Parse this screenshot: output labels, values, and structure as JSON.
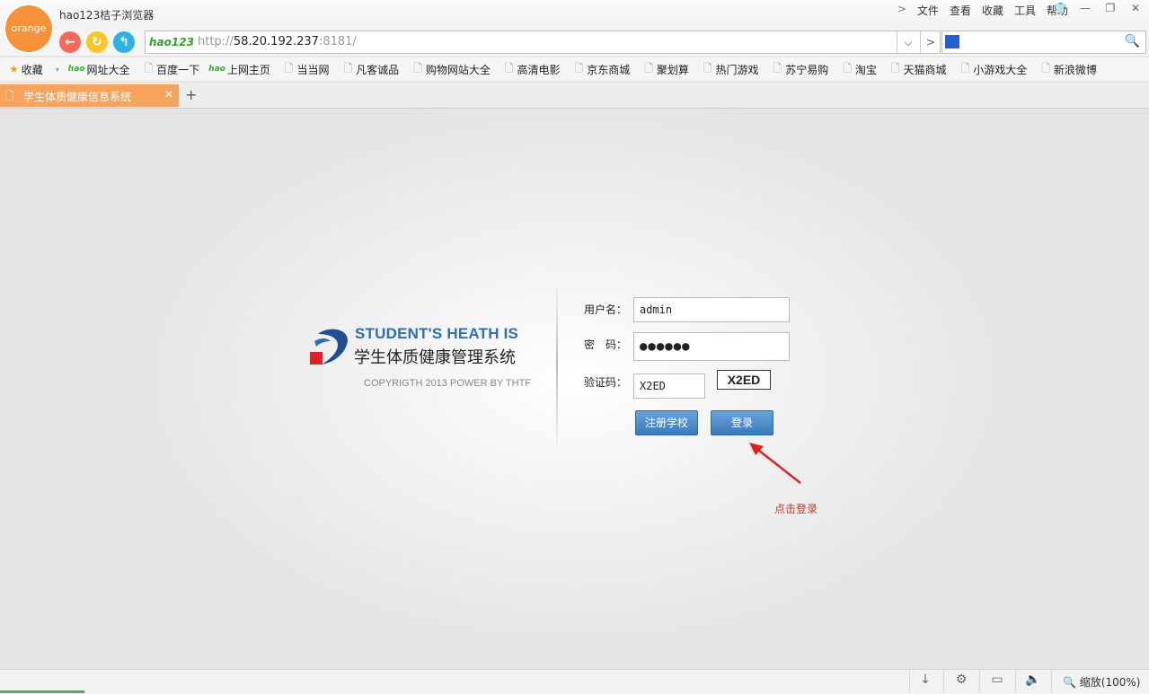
{
  "browser": {
    "logo_text": "orange",
    "title": "hao123桔子浏览器",
    "menu": [
      "文件",
      "查看",
      "收藏",
      "工具",
      "帮助"
    ],
    "address": {
      "badge": "hao123",
      "scheme": "http://",
      "host": "58.20.192.237",
      "port_path": ":8181/"
    },
    "search": {
      "placeholder": ""
    }
  },
  "bookmarks": {
    "favorites_label": "收藏",
    "items": [
      "网址大全",
      "百度一下",
      "上网主页",
      "当当网",
      "凡客诚品",
      "购物网站大全",
      "高清电影",
      "京东商城",
      "聚划算",
      "热门游戏",
      "苏宁易购",
      "淘宝",
      "天猫商城",
      "小游戏大全",
      "新浪微博"
    ]
  },
  "tab": {
    "label": "学生体质健康信息系统"
  },
  "login": {
    "brand_en": "STUDENT'S HEATH IS",
    "brand_cn": "学生体质健康管理系统",
    "copyright": "COPYRIGTH 2013 POWER BY THTF",
    "username_label": "用户名：",
    "username_value": "admin",
    "password_label": "密　码：",
    "password_value": "●●●●●●",
    "captcha_label": "验证码：",
    "captcha_value": "X2ED",
    "captcha_image_text": "X2ED",
    "register_label": "注册学校",
    "login_label": "登录",
    "hint": "点击登录"
  },
  "status": {
    "zoom": "缩放(100%)"
  },
  "colors": {
    "accent": "#f7923a",
    "button": "#3a7abb",
    "hint": "#c0392b"
  }
}
